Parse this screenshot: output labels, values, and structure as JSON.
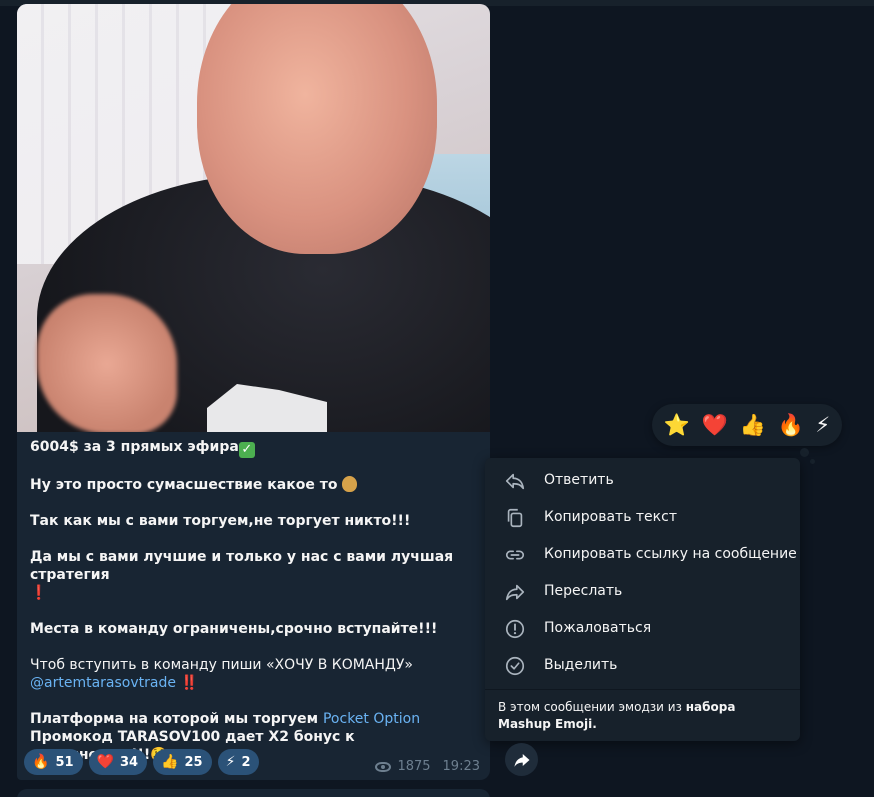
{
  "message": {
    "line1": "6004$ за 3 прямых эфира",
    "line2": "Ну это просто сумасшествие какое то",
    "line3": "Так как мы с вами торгуем,не торгует никто!!!",
    "line4": "Да мы с вами лучшие и только у нас с вами лучшая стратегия",
    "line5": "Места в команду ограничены,срочно вступайте!!!",
    "line6": "Чтоб вступить в команду пиши «ХОЧУ В КОМАНДУ»",
    "username": "@artemtarasovtrade",
    "line7_prefix": "Платформа на которой мы торгуем ",
    "platform_link": "Pocket Option",
    "line8": "Промокод TARASOV100 дает X2 бонус к пополнению!!!",
    "emoji_check": "✓",
    "emoji_excl": "❗",
    "emoji_double_excl": "‼️",
    "emoji_face": "🤑"
  },
  "reactions": [
    {
      "icon": "🔥",
      "count": "51"
    },
    {
      "icon": "❤️",
      "count": "34"
    },
    {
      "icon": "👍",
      "count": "25"
    },
    {
      "icon": "⚡",
      "count": "2"
    }
  ],
  "meta": {
    "views": "1875",
    "time": "19:23"
  },
  "picker": [
    "⭐",
    "❤️",
    "👍",
    "🔥",
    "⚡"
  ],
  "menu": {
    "items": [
      {
        "label": "Ответить",
        "icon": "reply-icon"
      },
      {
        "label": "Копировать текст",
        "icon": "copy-icon"
      },
      {
        "label": "Копировать ссылку на сообщение",
        "icon": "link-icon"
      },
      {
        "label": "Переслать",
        "icon": "forward-icon"
      },
      {
        "label": "Пожаловаться",
        "icon": "report-icon"
      },
      {
        "label": "Выделить",
        "icon": "select-icon"
      }
    ],
    "footnote_prefix": "В этом сообщении эмодзи из ",
    "footnote_bold": "набора Mashup Emoji."
  },
  "colors": {
    "background": "#0e1621",
    "bubble": "#182533",
    "menu": "#17212b",
    "link": "#6ab3f3",
    "reaction": "#2b5278"
  }
}
